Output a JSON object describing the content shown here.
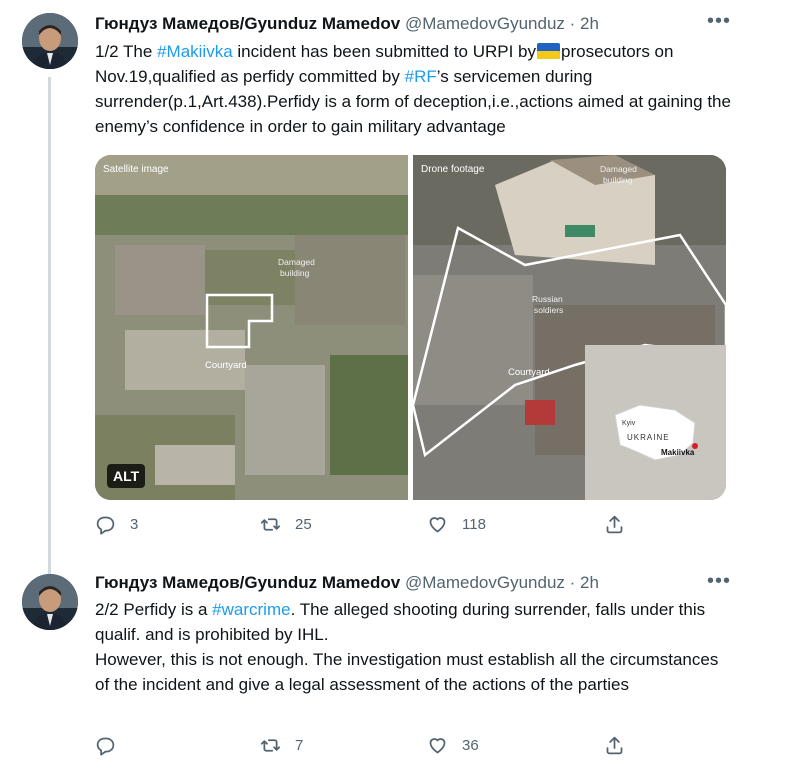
{
  "tweets": [
    {
      "author_name": "Гюндуз Мамедов/Gyunduz Mamedov",
      "handle": "@MamedovGyunduz",
      "time": "· 2h",
      "more_label": "•••",
      "text_parts": {
        "p1": "1/2 The ",
        "tag1": "#Makiivka",
        "p2": " incident has been submitted to URPI by",
        "p3": "prosecutors on Nov.19,qualified as perfidy committed by ",
        "tag2": "#RF",
        "p4": "’s servicemen during surrender(p.1,Art.438).Perfidy is a form of deception,i.e.,actions aimed at gaining the enemy’s confidence in order to gain military advantage"
      },
      "media": {
        "left_caption": "Satellite image",
        "right_caption": "Drone footage",
        "left_labels": {
          "damaged_line1": "Damaged",
          "damaged_line2": "building",
          "courtyard": "Courtyard"
        },
        "right_labels": {
          "damaged_line1": "Damaged",
          "damaged_line2": "building",
          "soldiers_line1": "Russian",
          "soldiers_line2": "soldiers",
          "courtyard": "Courtyard",
          "map_kyiv": "Kyiv",
          "map_country": "UKRAINE",
          "map_city": "Makiivka"
        },
        "alt_badge": "ALT"
      },
      "replies": "3",
      "retweets": "25",
      "likes": "118"
    },
    {
      "author_name": "Гюндуз Мамедов/Gyunduz Mamedov",
      "handle": "@MamedovGyunduz",
      "time": "· 2h",
      "more_label": "•••",
      "text_parts": {
        "p1": "2/2 Perfidy is a ",
        "tag1": "#warcrime",
        "p2": ". The alleged shooting during surrender, falls under this qualif. and is prohibited by IHL.",
        "p3": "However, this is not enough. The  investigation must establish all the circumstances of the incident and give a legal assessment of the actions of the parties"
      },
      "replies": "",
      "retweets": "7",
      "likes": "36"
    }
  ],
  "colors": {
    "link": "#1d9bf0",
    "muted": "#536471",
    "thread_line": "#cfd9de"
  },
  "icons": {
    "reply": "reply-icon",
    "retweet": "retweet-icon",
    "like": "heart-icon",
    "share": "share-icon",
    "flag": "ukraine-flag-emoji"
  }
}
